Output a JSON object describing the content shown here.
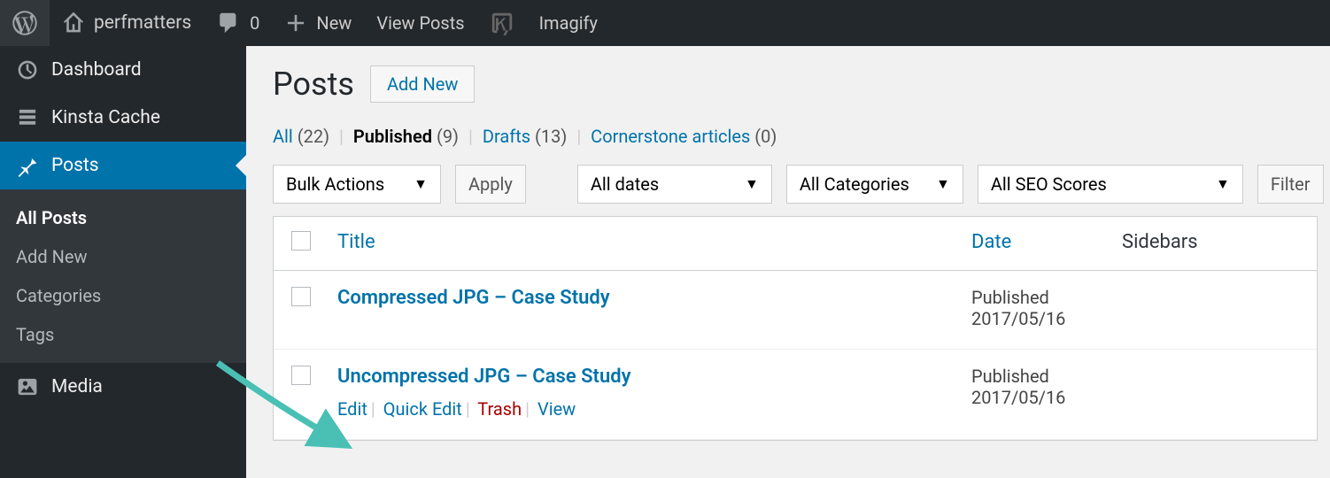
{
  "topbar": {
    "site_name": "perfmatters",
    "comment_count": "0",
    "new_label": "New",
    "view_posts": "View Posts",
    "imagify": "Imagify"
  },
  "sidebar": {
    "dashboard": "Dashboard",
    "kinsta_cache": "Kinsta Cache",
    "posts": "Posts",
    "media": "Media",
    "submenu": {
      "all_posts": "All Posts",
      "add_new": "Add New",
      "categories": "Categories",
      "tags": "Tags"
    }
  },
  "page": {
    "title": "Posts",
    "add_new_btn": "Add New"
  },
  "filters": {
    "all_label": "All",
    "all_count": "(22)",
    "published_label": "Published",
    "published_count": "(9)",
    "drafts_label": "Drafts",
    "drafts_count": "(13)",
    "cornerstone_label": "Cornerstone articles",
    "cornerstone_count": "(0)"
  },
  "tablenav": {
    "bulk_actions": "Bulk Actions",
    "apply": "Apply",
    "all_dates": "All dates",
    "all_categories": "All Categories",
    "all_seo": "All SEO Scores",
    "filter": "Filter"
  },
  "columns": {
    "title": "Title",
    "date": "Date",
    "sidebars": "Sidebars"
  },
  "rows": [
    {
      "title": "Compressed JPG – Case Study",
      "status": "Published",
      "date": "2017/05/16"
    },
    {
      "title": "Uncompressed JPG – Case Study",
      "status": "Published",
      "date": "2017/05/16"
    }
  ],
  "row_actions": {
    "edit": "Edit",
    "quick_edit": "Quick Edit",
    "trash": "Trash",
    "view": "View"
  }
}
